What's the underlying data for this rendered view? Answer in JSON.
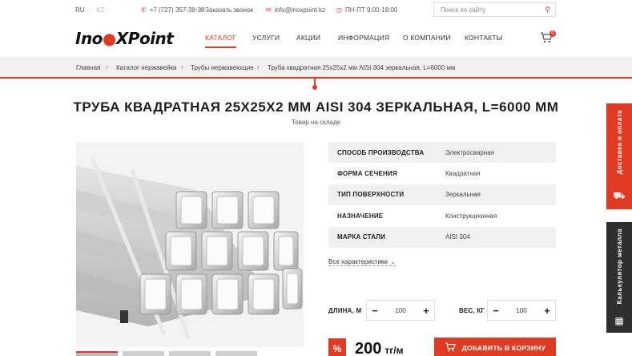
{
  "topbar": {
    "lang_active": "RU",
    "lang_inactive": "KZ",
    "phone": "+7 (727) 357-38-38",
    "callback": "Заказать звонок",
    "email": "info@inoxpoint.kz",
    "hours": "ПН-ПТ  9:00-18:00",
    "search_placeholder": "Поиск по сайту"
  },
  "logo": {
    "part1": "Ino",
    "dot": "●",
    "part2": "XPoint"
  },
  "nav": [
    "КАТАЛОГ",
    "УСЛУГИ",
    "АКЦИИ",
    "ИНФОРМАЦИЯ",
    "О КОМПАНИИ",
    "КОНТАКТЫ"
  ],
  "cart_count": "0",
  "breadcrumbs": [
    "Главная",
    "Каталог нержавейки",
    "Трубы нержавеющие",
    "Труба квадратная 25x25x2 мм AISI 304 зеркальная, L=6000 мм"
  ],
  "product": {
    "title": "ТРУБА КВАДРАТНАЯ 25X25X2 ММ AISI 304 ЗЕРКАЛЬНАЯ, L=6000 ММ",
    "stock": "Товар на складе",
    "specs": [
      {
        "name": "СПОСОБ ПРОИЗВОДСТВА",
        "value": "Электросварная"
      },
      {
        "name": "ФОРМА СЕЧЕНИЯ",
        "value": "Квадратная"
      },
      {
        "name": "ТИП ПОВЕРХНОСТИ",
        "value": "Зеркальная"
      },
      {
        "name": "НАЗНАЧЕНИЕ",
        "value": "Конструкционная"
      },
      {
        "name": "МАРКА СТАЛИ",
        "value": "AISI 304"
      }
    ],
    "all_specs": "Все характеристики",
    "length_label": "ДЛИНА, М",
    "length_value": "100",
    "weight_label": "ВЕС, КГ",
    "weight_value": "100",
    "discount_badge": "%",
    "price": "200",
    "price_unit": "тг/м",
    "add_to_cart": "ДОБАВИТЬ В КОРЗИНУ"
  },
  "side": {
    "delivery": "Доставка и оплата",
    "calculator": "Калькулятор металла"
  },
  "colors": {
    "accent": "#e03a22",
    "dark_tab": "#2f2f2f"
  }
}
